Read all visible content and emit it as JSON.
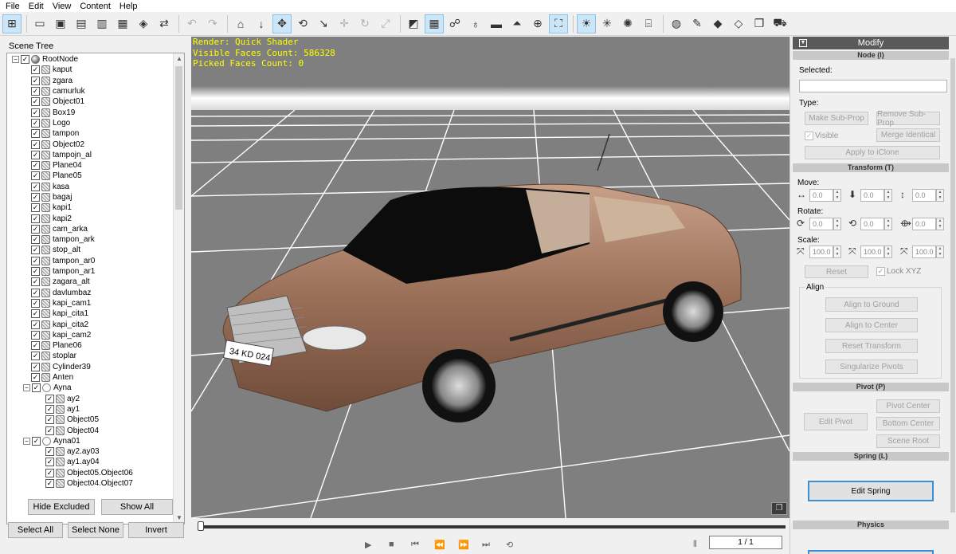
{
  "menu": [
    "File",
    "Edit",
    "View",
    "Content",
    "Help"
  ],
  "toolbar_icons": [
    "scene-tree-icon",
    "open-folder-icon",
    "save-icon",
    "save-as-icon",
    "export-icon",
    "import-icon",
    "render-icon",
    "sync-icon",
    "undo-icon",
    "redo-icon",
    "home-icon",
    "down-arrow-icon",
    "move-icon",
    "rotate-icon",
    "pick-icon",
    "pan-icon",
    "refresh-icon",
    "resize-icon",
    "wire-icon",
    "grid-icon",
    "bone-icon",
    "pin-icon",
    "box-icon",
    "light-icon",
    "globe-icon",
    "fit-icon",
    "sun-icon",
    "spot-icon",
    "bulb-icon",
    "museum-icon",
    "world-icon",
    "wrench-icon",
    "material-icon",
    "texture-icon",
    "copy-icon",
    "cart-icon"
  ],
  "scene_tree": {
    "title": "Scene Tree",
    "nodes": [
      {
        "label": "RootNode",
        "level": 0,
        "kind": "root"
      },
      {
        "label": "kaput",
        "level": 1
      },
      {
        "label": "zgara",
        "level": 1
      },
      {
        "label": "camurluk",
        "level": 1
      },
      {
        "label": "Object01",
        "level": 1
      },
      {
        "label": "Box19",
        "level": 1
      },
      {
        "label": "Logo",
        "level": 1
      },
      {
        "label": "tampon",
        "level": 1
      },
      {
        "label": "Object02",
        "level": 1
      },
      {
        "label": "tampojn_al",
        "level": 1
      },
      {
        "label": "Plane04",
        "level": 1
      },
      {
        "label": "Plane05",
        "level": 1
      },
      {
        "label": "kasa",
        "level": 1
      },
      {
        "label": "bagaj",
        "level": 1
      },
      {
        "label": "kapi1",
        "level": 1
      },
      {
        "label": "kapi2",
        "level": 1
      },
      {
        "label": "cam_arka",
        "level": 1
      },
      {
        "label": "tampon_ark",
        "level": 1
      },
      {
        "label": "stop_alt",
        "level": 1
      },
      {
        "label": "tampon_ar0",
        "level": 1
      },
      {
        "label": "tampon_ar1",
        "level": 1
      },
      {
        "label": "zagara_alt",
        "level": 1
      },
      {
        "label": "davlumbaz",
        "level": 1
      },
      {
        "label": "kapi_cam1",
        "level": 1
      },
      {
        "label": "kapi_cita1",
        "level": 1
      },
      {
        "label": "kapi_cita2",
        "level": 1
      },
      {
        "label": "kapi_cam2",
        "level": 1
      },
      {
        "label": "Plane06",
        "level": 1
      },
      {
        "label": "stoplar",
        "level": 1
      },
      {
        "label": "Cylinder39",
        "level": 1
      },
      {
        "label": "Anten",
        "level": 1
      },
      {
        "label": "Ayna",
        "level": 1,
        "kind": "group"
      },
      {
        "label": "ay2",
        "level": 2
      },
      {
        "label": "ay1",
        "level": 2
      },
      {
        "label": "Object05",
        "level": 2
      },
      {
        "label": "Object04",
        "level": 2
      },
      {
        "label": "Ayna01",
        "level": 1,
        "kind": "group"
      },
      {
        "label": "ay2.ay03",
        "level": 2
      },
      {
        "label": "ay1.ay04",
        "level": 2
      },
      {
        "label": "Object05.Object06",
        "level": 2
      },
      {
        "label": "Object04.Object07",
        "level": 2
      }
    ],
    "hide_excluded": "Hide Excluded",
    "show_all": "Show All",
    "select_all": "Select All",
    "select_none": "Select None",
    "invert": "Invert"
  },
  "viewport": {
    "render": "Render: Quick Shader",
    "visible_faces": "Visible Faces Count: 586328",
    "picked_faces": "Picked Faces Count: 0",
    "plate": "34 KD 024"
  },
  "timeline": {
    "frame": "1 / 1"
  },
  "modify": {
    "title": "Modify",
    "node_section": "Node (I)",
    "selected_label": "Selected:",
    "type_label": "Type:",
    "make_sub_prop": "Make Sub-Prop",
    "remove_sub_prop": "Remove Sub-Prop",
    "visible": "Visible",
    "merge_identical": "Merge Identical",
    "apply_iclone": "Apply to iClone",
    "transform_section": "Transform (T)",
    "move_label": "Move:",
    "rotate_label": "Rotate:",
    "scale_label": "Scale:",
    "move": [
      "0.0",
      "0.0",
      "0.0"
    ],
    "rotate": [
      "0.0",
      "0.0",
      "0.0"
    ],
    "scale": [
      "100.0",
      "100.0",
      "100.0"
    ],
    "reset": "Reset",
    "lock_xyz": "Lock XYZ",
    "align_label": "Align",
    "align_ground": "Align to Ground",
    "align_center": "Align to Center",
    "reset_transform": "Reset Transform",
    "singularize": "Singularize Pivots",
    "pivot_section": "Pivot (P)",
    "edit_pivot": "Edit Pivot",
    "pivot_center": "Pivot Center",
    "bottom_center": "Bottom Center",
    "scene_root": "Scene Root",
    "spring_section": "Spring (L)",
    "edit_spring": "Edit Spring",
    "physics_section": "Physics"
  }
}
